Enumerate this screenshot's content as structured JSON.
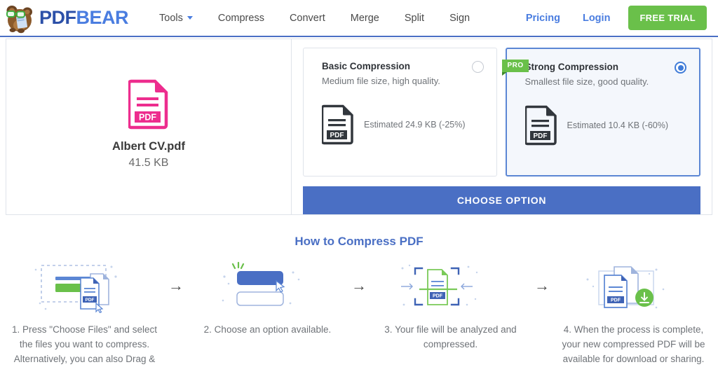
{
  "header": {
    "brand": {
      "pdf": "PDF",
      "bear": "BEAR"
    },
    "nav": [
      {
        "label": "Tools",
        "has_caret": true
      },
      {
        "label": "Compress",
        "has_caret": false
      },
      {
        "label": "Convert",
        "has_caret": false
      },
      {
        "label": "Merge",
        "has_caret": false
      },
      {
        "label": "Split",
        "has_caret": false
      },
      {
        "label": "Sign",
        "has_caret": false
      }
    ],
    "pricing_label": "Pricing",
    "login_label": "Login",
    "free_trial_label": "FREE TRIAL",
    "accent_blue": "#4a7de0",
    "accent_green": "#6ac04a"
  },
  "file": {
    "name": "Albert CV.pdf",
    "size": "41.5 KB",
    "icon_color": "#ED2D8E",
    "icon_label": "PDF"
  },
  "options": {
    "basic": {
      "title": "Basic Compression",
      "subtitle": "Medium file size, high quality.",
      "estimate": "Estimated 24.9 KB (-25%)",
      "icon_label": "PDF",
      "selected": false
    },
    "strong": {
      "title": "Strong Compression",
      "subtitle": "Smallest file size, good quality.",
      "estimate": "Estimated 10.4 KB (-60%)",
      "icon_label": "PDF",
      "badge": "PRO",
      "selected": true
    },
    "choose_button": "CHOOSE OPTION"
  },
  "howto": {
    "title": "How to Compress PDF",
    "arrow": "→",
    "steps": [
      {
        "text": "1. Press \"Choose Files\" and select the files you want to compress. Alternatively, you can also Drag &"
      },
      {
        "text": "2. Choose an option available."
      },
      {
        "text": "3. Your file will be analyzed and compressed."
      },
      {
        "text": "4. When the process is complete, your new compressed PDF will be available for download or sharing."
      }
    ]
  }
}
